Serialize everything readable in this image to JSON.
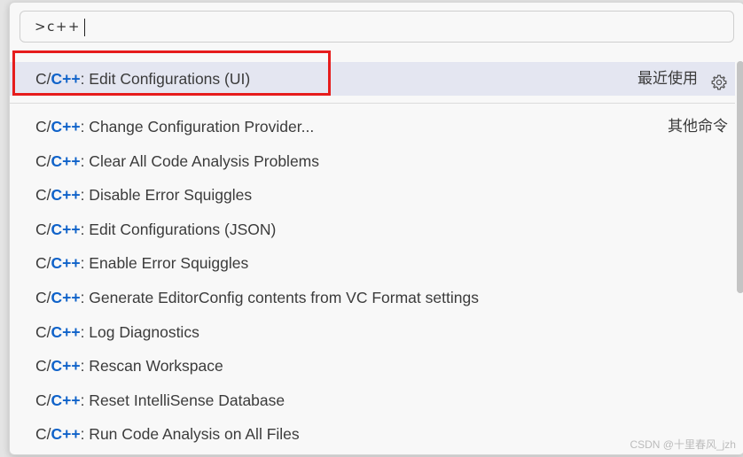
{
  "search": {
    "value": ">c++"
  },
  "selected_item": {
    "prefix": "C/",
    "cpp": "C++",
    "label": ": Edit Configurations (UI)",
    "badge": "最近使用",
    "icon": "gear-icon"
  },
  "group_label": "其他命令",
  "items": [
    {
      "prefix": "C/",
      "cpp": "C++",
      "label": ": Change Configuration Provider..."
    },
    {
      "prefix": "C/",
      "cpp": "C++",
      "label": ": Clear All Code Analysis Problems"
    },
    {
      "prefix": "C/",
      "cpp": "C++",
      "label": ": Disable Error Squiggles"
    },
    {
      "prefix": "C/",
      "cpp": "C++",
      "label": ": Edit Configurations (JSON)"
    },
    {
      "prefix": "C/",
      "cpp": "C++",
      "label": ": Enable Error Squiggles"
    },
    {
      "prefix": "C/",
      "cpp": "C++",
      "label": ": Generate EditorConfig contents from VC Format settings"
    },
    {
      "prefix": "C/",
      "cpp": "C++",
      "label": ": Log Diagnostics"
    },
    {
      "prefix": "C/",
      "cpp": "C++",
      "label": ": Rescan Workspace"
    },
    {
      "prefix": "C/",
      "cpp": "C++",
      "label": ": Reset IntelliSense Database"
    },
    {
      "prefix": "C/",
      "cpp": "C++",
      "label": ": Run Code Analysis on All Files"
    }
  ],
  "watermark": "CSDN @十里春风_jzh",
  "colors": {
    "accent_cpp": "#0f62c9",
    "selection_bg": "#e4e6f1",
    "annotation_box": "#e61c1c"
  }
}
